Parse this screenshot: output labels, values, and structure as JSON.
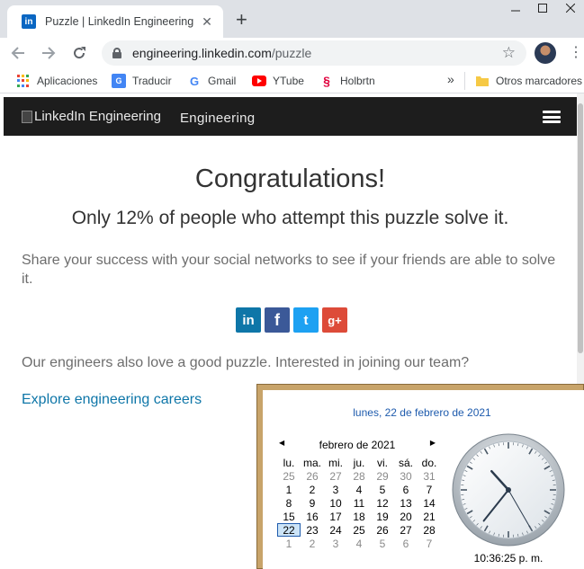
{
  "browser": {
    "tab_title": "Puzzle | LinkedIn Engineering",
    "tab_favicon": "in",
    "url_host": "engineering.linkedin.com",
    "url_path": "/puzzle",
    "bookmarks": [
      {
        "label": "Aplicaciones",
        "icon": "apps-grid-icon"
      },
      {
        "label": "Traducir",
        "icon": "translate-icon"
      },
      {
        "label": "Gmail",
        "icon": "google-icon"
      },
      {
        "label": "YTube",
        "icon": "youtube-icon"
      },
      {
        "label": "Holbrtn",
        "icon": "holberton-icon"
      }
    ],
    "bookmarks_overflow": "»",
    "other_bookmarks": "Otros marcadores"
  },
  "site": {
    "logo_alt": "LinkedIn Engineering",
    "brand": "Engineering"
  },
  "main": {
    "heading": "Congratulations!",
    "subheading": "Only 12% of people who attempt this puzzle solve it.",
    "share_text": "Share your success with your social networks to see if your friends are able to solve it.",
    "social": [
      {
        "label": "in",
        "name": "linkedin-icon",
        "color": "#0e76a8"
      },
      {
        "label": "f",
        "name": "facebook-icon",
        "color": "#3b5998"
      },
      {
        "label": "t",
        "name": "twitter-icon",
        "color": "#1da1f2"
      },
      {
        "label": "g+",
        "name": "google-plus-icon",
        "color": "#dd4b39"
      }
    ],
    "engineers_text": "Our engineers also love a good puzzle. Interested in joining our team?",
    "careers_link": "Explore engineering careers"
  },
  "calendar": {
    "long_date": "lunes, 22 de febrero de 2021",
    "month_label": "febrero de 2021",
    "weekdays": [
      "lu.",
      "ma.",
      "mi.",
      "ju.",
      "vi.",
      "sá.",
      "do."
    ],
    "weeks": [
      [
        "25",
        "26",
        "27",
        "28",
        "29",
        "30",
        "31"
      ],
      [
        "1",
        "2",
        "3",
        "4",
        "5",
        "6",
        "7"
      ],
      [
        "8",
        "9",
        "10",
        "11",
        "12",
        "13",
        "14"
      ],
      [
        "15",
        "16",
        "17",
        "18",
        "19",
        "20",
        "21"
      ],
      [
        "22",
        "23",
        "24",
        "25",
        "26",
        "27",
        "28"
      ],
      [
        "1",
        "2",
        "3",
        "4",
        "5",
        "6",
        "7"
      ]
    ],
    "other_month_rows": [
      0,
      5
    ],
    "today": "22",
    "time": "10:36:25 p. m.",
    "clock": {
      "hour": 10,
      "minute": 36,
      "second": 25
    }
  }
}
